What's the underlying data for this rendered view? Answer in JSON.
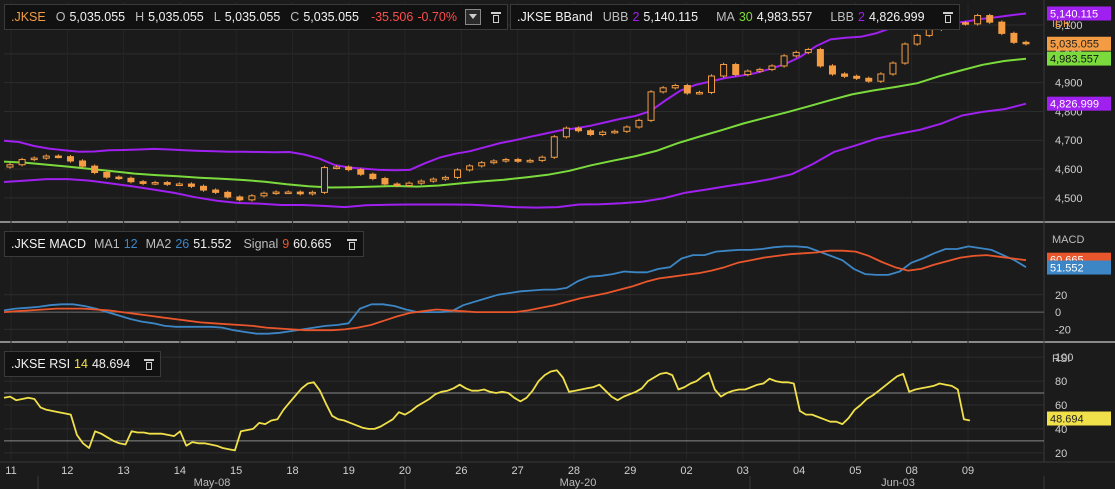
{
  "colors": {
    "orange": "#f39c44",
    "purple": "#a020f0",
    "green": "#7cdb3c",
    "macd": "#3d86c6",
    "signal": "#e9562c",
    "rsi": "#f0e04a",
    "neg": "#ff4d4d"
  },
  "price_legend": {
    "symbol": ".JKSE",
    "o_label": "O",
    "o_value": "5,035.055",
    "h_label": "H",
    "h_value": "5,035.055",
    "l_label": "L",
    "l_value": "5,035.055",
    "c_label": "C",
    "c_value": "5,035.055",
    "change": "-35.506",
    "change_pct": "-0.70%"
  },
  "bband_legend": {
    "name": ".JKSE BBand",
    "ubb_label": "UBB",
    "ubb_period": "2",
    "ubb_value": "5,140.115",
    "ma_label": "MA",
    "ma_period": "30",
    "ma_value": "4,983.557",
    "lbb_label": "LBB",
    "lbb_period": "2",
    "lbb_value": "4,826.999"
  },
  "macd_legend": {
    "name": ".JKSE MACD",
    "ma1_label": "MA1",
    "ma1_value": "12",
    "ma2_label": "MA2",
    "ma2_value": "26",
    "macd_value": "51.552",
    "signal_label": "Signal",
    "signal_period": "9",
    "signal_value": "60.665"
  },
  "rsi_legend": {
    "name": ".JKSE RSI",
    "period": "14",
    "value": "48.694"
  },
  "price_axis": {
    "title": "Price",
    "currency": "IDR"
  },
  "macd_axis": {
    "title": "MACD"
  },
  "rsi_axis": {
    "title": "RSI"
  },
  "chart_data": [
    {
      "type": "candlestick",
      "title": ".JKSE",
      "x_day_labels": [
        "11",
        "12",
        "13",
        "14",
        "15",
        "18",
        "19",
        "20",
        "26",
        "27",
        "28",
        "29",
        "02",
        "03",
        "04",
        "05",
        "08",
        "09"
      ],
      "x_month_labels": [
        "May-08",
        "May-20",
        "Jun-03"
      ],
      "ylim": [
        4430,
        5180
      ],
      "yticks": [
        4500,
        4600,
        4700,
        4800,
        4900,
        5000,
        5100
      ],
      "ytick_labels": [
        "4,500",
        "4,600",
        "4,700",
        "4,800",
        "4,900",
        "5,000",
        "5,100"
      ],
      "grid": true,
      "close_series": [
        4615,
        4633,
        4638,
        4645,
        4643,
        4628,
        4610,
        4588,
        4572,
        4568,
        4556,
        4550,
        4553,
        4547,
        4548,
        4540,
        4527,
        4519,
        4503,
        4493,
        4507,
        4516,
        4520,
        4520,
        4514,
        4519,
        4605,
        4607,
        4598,
        4582,
        4567,
        4548,
        4543,
        4551,
        4558,
        4565,
        4571,
        4597,
        4611,
        4622,
        4628,
        4633,
        4627,
        4630,
        4641,
        4712,
        4742,
        4733,
        4720,
        4728,
        4731,
        4746,
        4769,
        4868,
        4882,
        4890,
        4864,
        4866,
        4923,
        4963,
        4928,
        4940,
        4946,
        4958,
        4993,
        5005,
        5015,
        4958,
        4930,
        4922,
        4915,
        4905,
        4930,
        4968,
        5034,
        5064,
        5085,
        5095,
        5108,
        5104,
        5133,
        5110,
        5071,
        5040,
        5035
      ],
      "series_lines": [
        {
          "name": "UBB",
          "color": "#a020f0",
          "values": [
            4698,
            4694,
            4680,
            4671,
            4665,
            4660,
            4661,
            4665,
            4666,
            4668,
            4670,
            4668,
            4665,
            4663,
            4662,
            4660,
            4660,
            4659,
            4658,
            4659,
            4650,
            4636,
            4614,
            4605,
            4601,
            4597,
            4596,
            4597,
            4620,
            4640,
            4653,
            4662,
            4676,
            4690,
            4700,
            4712,
            4723,
            4734,
            4741,
            4750,
            4762,
            4774,
            4784,
            4801,
            4838,
            4872,
            4892,
            4904,
            4916,
            4924,
            4933,
            4948,
            4965,
            4990,
            5026,
            5050,
            5056,
            5059,
            5071,
            5089,
            5095,
            5098,
            5103,
            5106,
            5112,
            5121,
            5127,
            5134,
            5140
          ]
        },
        {
          "name": "MA",
          "color": "#7cdb3c",
          "values": [
            4626,
            4622,
            4615,
            4608,
            4600,
            4592,
            4584,
            4579,
            4575,
            4570,
            4566,
            4562,
            4556,
            4547,
            4540,
            4536,
            4537,
            4539,
            4541,
            4539,
            4543,
            4550,
            4557,
            4563,
            4571,
            4580,
            4594,
            4613,
            4629,
            4644,
            4663,
            4690,
            4713,
            4735,
            4758,
            4778,
            4797,
            4818,
            4839,
            4859,
            4873,
            4885,
            4898,
            4922,
            4942,
            4962,
            4975,
            4983
          ]
        },
        {
          "name": "LBB",
          "color": "#a020f0",
          "values": [
            4555,
            4560,
            4565,
            4565,
            4560,
            4550,
            4540,
            4529,
            4517,
            4502,
            4490,
            4482,
            4480,
            4475,
            4475,
            4472,
            4468,
            4474,
            4476,
            4477,
            4477,
            4477,
            4476,
            4472,
            4468,
            4466,
            4468,
            4477,
            4478,
            4481,
            4487,
            4499,
            4518,
            4529,
            4541,
            4552,
            4565,
            4582,
            4618,
            4660,
            4682,
            4706,
            4722,
            4736,
            4757,
            4786,
            4799,
            4808,
            4827
          ]
        }
      ],
      "last_labels": [
        {
          "series": "UBB",
          "value": 5140.115,
          "text": "5,140.115",
          "bg": "#a020f0",
          "fg": "#ffffff"
        },
        {
          "series": "Close",
          "value": 5035.055,
          "text": "5,035.055",
          "bg": "#f39c44",
          "fg": "#222222"
        },
        {
          "series": "MA",
          "value": 4983.557,
          "text": "4,983.557",
          "bg": "#7cdb3c",
          "fg": "#111111"
        },
        {
          "series": "LBB",
          "value": 4826.999,
          "text": "4,826.999",
          "bg": "#a020f0",
          "fg": "#ffffff"
        }
      ]
    },
    {
      "type": "line",
      "title": ".JKSE MACD",
      "ylim": [
        -30,
        95
      ],
      "yticks": [
        -20,
        0,
        20
      ],
      "ytick_labels": [
        "-20",
        "0",
        "20"
      ],
      "grid": true,
      "series": [
        {
          "name": "MACD",
          "color": "#3d86c6",
          "values": [
            2,
            4,
            5,
            6,
            8,
            9,
            9,
            7,
            4,
            0,
            -4,
            -8,
            -11,
            -13,
            -16,
            -17,
            -17,
            -17,
            -17,
            -18,
            -21,
            -23,
            -25,
            -25,
            -24,
            -22,
            -20,
            -18,
            -16,
            -15,
            -13,
            4,
            9,
            9,
            7,
            3,
            0,
            0,
            0,
            1,
            8,
            12,
            16,
            20,
            22,
            24,
            25,
            26,
            26,
            28,
            36,
            41,
            42,
            44,
            47,
            46,
            46,
            50,
            52,
            62,
            66,
            66,
            70,
            71,
            72,
            72,
            73,
            75,
            76,
            76,
            75,
            70,
            65,
            60,
            50,
            44,
            43,
            43,
            47,
            57,
            62,
            68,
            73,
            73,
            76,
            74,
            72,
            66,
            60,
            52
          ]
        },
        {
          "name": "Signal",
          "color": "#e9562c",
          "values": [
            0,
            1,
            2,
            3,
            4,
            4,
            4,
            3,
            2,
            0,
            -2,
            -4,
            -6,
            -8,
            -10,
            -12,
            -13,
            -14,
            -15,
            -16,
            -18,
            -19,
            -20,
            -21,
            -21,
            -21,
            -20,
            -18,
            -15,
            -10,
            -5,
            -1,
            1,
            3,
            2,
            1,
            0,
            0,
            0,
            0,
            2,
            5,
            8,
            12,
            16,
            19,
            22,
            26,
            30,
            35,
            39,
            41,
            43,
            45,
            48,
            52,
            57,
            60,
            63,
            65,
            67,
            68,
            69,
            71,
            71,
            70,
            65,
            58,
            52,
            48,
            50,
            55,
            59,
            63,
            65,
            66,
            64,
            62,
            60
          ]
        }
      ],
      "last_labels": [
        {
          "series": "Signal",
          "value": 60.665,
          "text": "60.665",
          "bg": "#e9562c",
          "fg": "#ffffff"
        },
        {
          "series": "MACD",
          "value": 51.552,
          "text": "51.552",
          "bg": "#3d86c6",
          "fg": "#ffffff"
        }
      ]
    },
    {
      "type": "line",
      "title": ".JKSE RSI",
      "ylim": [
        14,
        106
      ],
      "yticks": [
        20,
        40,
        60,
        80,
        100
      ],
      "ytick_labels": [
        "20",
        "40",
        "60",
        "80",
        "100"
      ],
      "reference_lines": [
        70,
        30
      ],
      "grid": true,
      "series": [
        {
          "name": "RSI",
          "color": "#f0e04a",
          "values": [
            66,
            67,
            64,
            65,
            66,
            65,
            58,
            56,
            55,
            54,
            53,
            52,
            35,
            28,
            24,
            38,
            36,
            33,
            30,
            28,
            27,
            38,
            37,
            37,
            36,
            36,
            36,
            35,
            34,
            38,
            26,
            29,
            28,
            28,
            27,
            26,
            24,
            23,
            22,
            38,
            39,
            40,
            45,
            44,
            47,
            48,
            56,
            62,
            68,
            74,
            78,
            79,
            72,
            61,
            51,
            48,
            47,
            45,
            43,
            41,
            40,
            40,
            42,
            45,
            48,
            54,
            52,
            55,
            59,
            62,
            65,
            69,
            71,
            72,
            74,
            77,
            74,
            72,
            72,
            73,
            71,
            70,
            71,
            70,
            66,
            63,
            66,
            72,
            80,
            85,
            88,
            89,
            83,
            71,
            72,
            73,
            74,
            75,
            77,
            72,
            67,
            64,
            67,
            69,
            71,
            74,
            80,
            83,
            86,
            87,
            85,
            73,
            75,
            78,
            80,
            84,
            87,
            73,
            67,
            70,
            72,
            73,
            73,
            75,
            77,
            78,
            82,
            80,
            79,
            79,
            78,
            55,
            52,
            52,
            50,
            48,
            46,
            46,
            44,
            49,
            56,
            60,
            65,
            68,
            72,
            76,
            80,
            84,
            86,
            71,
            73,
            74,
            75,
            76,
            78,
            77,
            76,
            73,
            48,
            47
          ]
        }
      ],
      "last_labels": [
        {
          "series": "RSI",
          "value": 48.694,
          "text": "48.694",
          "bg": "#f0e04a",
          "fg": "#222222"
        }
      ]
    }
  ]
}
